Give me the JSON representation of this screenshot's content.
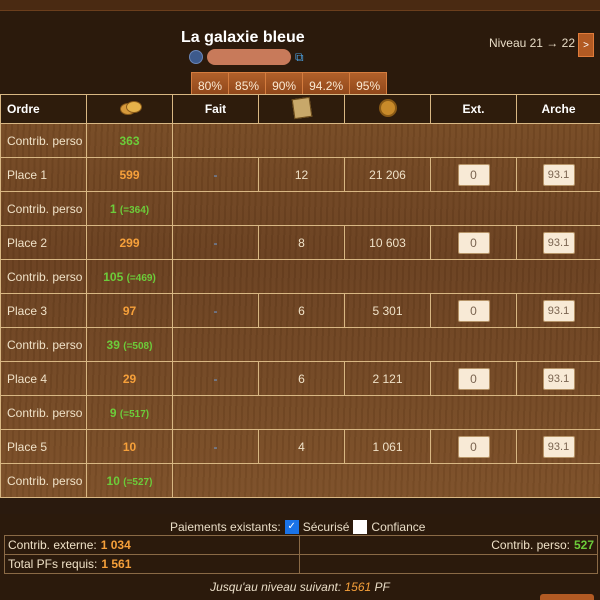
{
  "header": {
    "title": "La galaxie bleue",
    "owner_name": "",
    "level_text": "Niveau 21 → 22",
    "next_button": ">",
    "percent_buttons": [
      "80%",
      "85%",
      "90%",
      "94.2%",
      "95%"
    ]
  },
  "table": {
    "columns": {
      "ordre": "Ordre",
      "fait": "Fait",
      "ext": "Ext.",
      "arche": "Arche"
    },
    "rows": [
      {
        "type": "perso",
        "label": "Contrib. perso",
        "value": "363",
        "paren": ""
      },
      {
        "type": "place",
        "label": "Place 1",
        "value": "599",
        "fait": "-",
        "plans": "12",
        "medals": "21 206",
        "ext": "0",
        "arche": "93.1"
      },
      {
        "type": "perso",
        "label": "Contrib. perso",
        "value": "1",
        "paren": "(=364)"
      },
      {
        "type": "place",
        "label": "Place 2",
        "value": "299",
        "fait": "-",
        "plans": "8",
        "medals": "10 603",
        "ext": "0",
        "arche": "93.1"
      },
      {
        "type": "perso",
        "label": "Contrib. perso",
        "value": "105",
        "paren": "(=469)"
      },
      {
        "type": "place",
        "label": "Place 3",
        "value": "97",
        "fait": "-",
        "plans": "6",
        "medals": "5 301",
        "ext": "0",
        "arche": "93.1"
      },
      {
        "type": "perso",
        "label": "Contrib. perso",
        "value": "39",
        "paren": "(=508)"
      },
      {
        "type": "place",
        "label": "Place 4",
        "value": "29",
        "fait": "-",
        "plans": "6",
        "medals": "2 121",
        "ext": "0",
        "arche": "93.1"
      },
      {
        "type": "perso",
        "label": "Contrib. perso",
        "value": "9",
        "paren": "(=517)"
      },
      {
        "type": "place",
        "label": "Place 5",
        "value": "10",
        "fait": "-",
        "plans": "4",
        "medals": "1 061",
        "ext": "0",
        "arche": "93.1"
      },
      {
        "type": "perso",
        "label": "Contrib. perso",
        "value": "10",
        "paren": "(=527)"
      }
    ]
  },
  "footer": {
    "payments_label": "Paiements existants:",
    "secure_label": "Sécurisé",
    "secure_checked": true,
    "trust_label": "Confiance",
    "trust_checked": false,
    "contrib_externe_label": "Contrib. externe:",
    "contrib_externe_value": "1 034",
    "contrib_perso_label": "Contrib. perso:",
    "contrib_perso_value": "527",
    "total_label": "Total PFs requis:",
    "total_value": "1 561",
    "next_level_label": "Jusqu'au niveau suivant:",
    "next_level_value": "1561",
    "next_level_unit": "PF"
  },
  "colors": {
    "accent_orange": "#f6a03a",
    "accent_green": "#6ccc3a",
    "button_brown": "#b25a23"
  }
}
